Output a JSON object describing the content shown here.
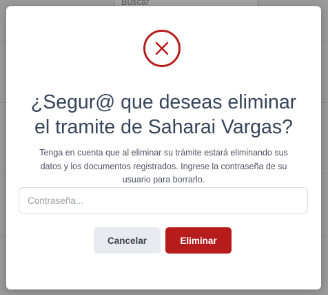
{
  "background": {
    "search_placeholder": "Buscar"
  },
  "dialog": {
    "icon": "close-circle-icon",
    "title_line1": "¿Segur@ que deseas eliminar",
    "title_line2": "el tramite de Saharai Vargas?",
    "description_line1": "Tenga en cuenta que al eliminar su trámite estará eliminando sus",
    "description_line2": "datos y los documentos registrados. Ingrese la contraseña de su",
    "description_line3": "usuario para borrarlo.",
    "password_placeholder": "Contraseña...",
    "cancel_label": "Cancelar",
    "delete_label": "Eliminar"
  },
  "colors": {
    "danger": "#b71c1c",
    "title": "#37455a",
    "cancel_bg": "#e7eaef"
  }
}
